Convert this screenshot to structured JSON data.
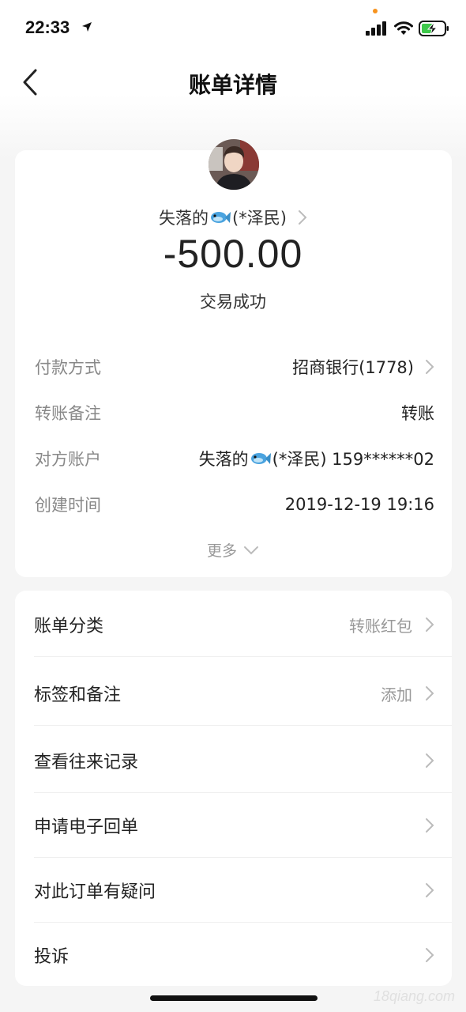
{
  "status_bar": {
    "time": "22:33"
  },
  "nav": {
    "title": "账单详情"
  },
  "summary": {
    "payee_name": "失落的",
    "payee_suffix": "(*泽民)",
    "amount": "-500.00",
    "status": "交易成功"
  },
  "details": [
    {
      "label": "付款方式",
      "value": "招商银行(1778)"
    },
    {
      "label": "转账备注",
      "value": "转账"
    },
    {
      "label": "对方账户",
      "value_name": "失落的",
      "value_suffix": "(*泽民) 159******02"
    },
    {
      "label": "创建时间",
      "value": "2019-12-19 19:16"
    }
  ],
  "more_label": "更多",
  "menu": [
    {
      "label": "账单分类",
      "value": "转账红包"
    },
    {
      "label": "标签和备注",
      "value": "添加"
    },
    {
      "label": "查看往来记录",
      "value": ""
    },
    {
      "label": "申请电子回单",
      "value": ""
    },
    {
      "label": "对此订单有疑问",
      "value": ""
    },
    {
      "label": "投诉",
      "value": ""
    }
  ],
  "watermark": "18qiang.com",
  "icons": {
    "back": "chevron-left-icon",
    "fish": "fish-emoji-icon",
    "chevron": "chevron-right-icon"
  },
  "colors": {
    "background": "#f5f5f5",
    "card": "#ffffff",
    "label_gray": "#888888",
    "value_gray": "#999999",
    "text": "#222222",
    "fish_blue": "#4aa3df"
  }
}
